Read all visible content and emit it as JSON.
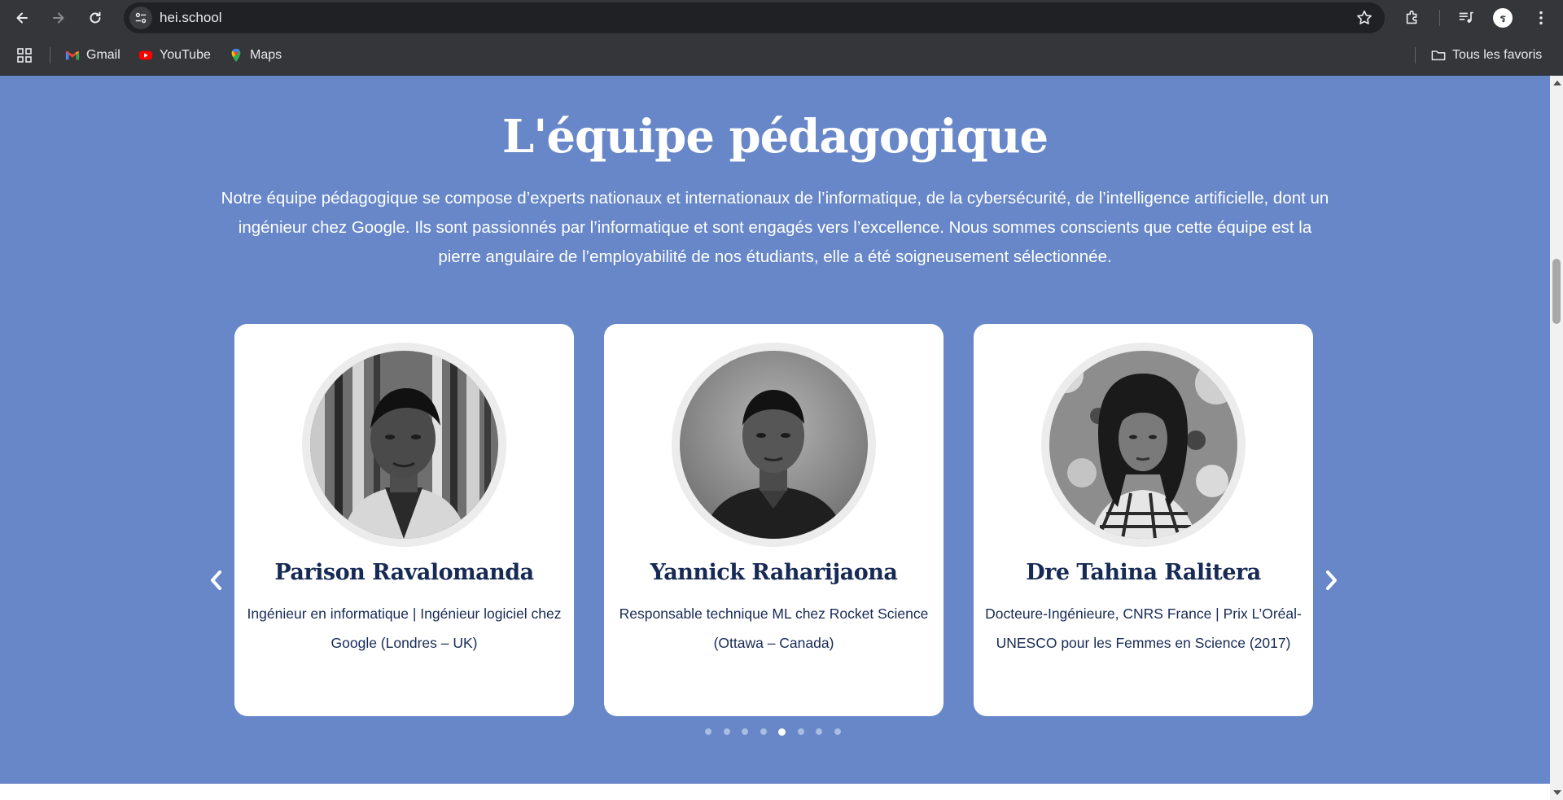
{
  "browser": {
    "url": "hei.school",
    "avatar_letter": "ร",
    "bookmarks": [
      {
        "label": "Gmail",
        "icon": "gmail-icon"
      },
      {
        "label": "YouTube",
        "icon": "youtube-icon"
      },
      {
        "label": "Maps",
        "icon": "maps-icon"
      }
    ],
    "all_bookmarks_label": "Tous les favoris"
  },
  "page": {
    "title": "L'équipe pédagogique",
    "intro": "Notre équipe pédagogique se compose d’experts nationaux et internationaux de l’informatique, de la cybersécurité, de l’intelligence artificielle, dont un ingénieur chez Google. Ils sont passionnés par l’informatique et sont engagés vers l’excellence. Nous sommes conscients que cette équipe est la pierre angulaire de l’employabilité de nos étudiants, elle a été soigneusement sélectionnée.",
    "background_color": "#6787c8",
    "text_color": "#172a55",
    "carousel": {
      "cards": [
        {
          "name": "Parison Ravalomanda",
          "description": "Ingénieur en informatique |  Ingénieur logiciel chez Google (Londres – UK)"
        },
        {
          "name": "Yannick Raharijaona",
          "description": "Responsable technique ML chez Rocket Science (Ottawa – Canada)"
        },
        {
          "name": "Dre Tahina Ralitera",
          "description": "Docteure-Ingénieure, CNRS France | Prix L’Oréal-UNESCO pour les Femmes en Science (2017)"
        }
      ],
      "dot_count": 8,
      "active_dot": 5
    }
  }
}
